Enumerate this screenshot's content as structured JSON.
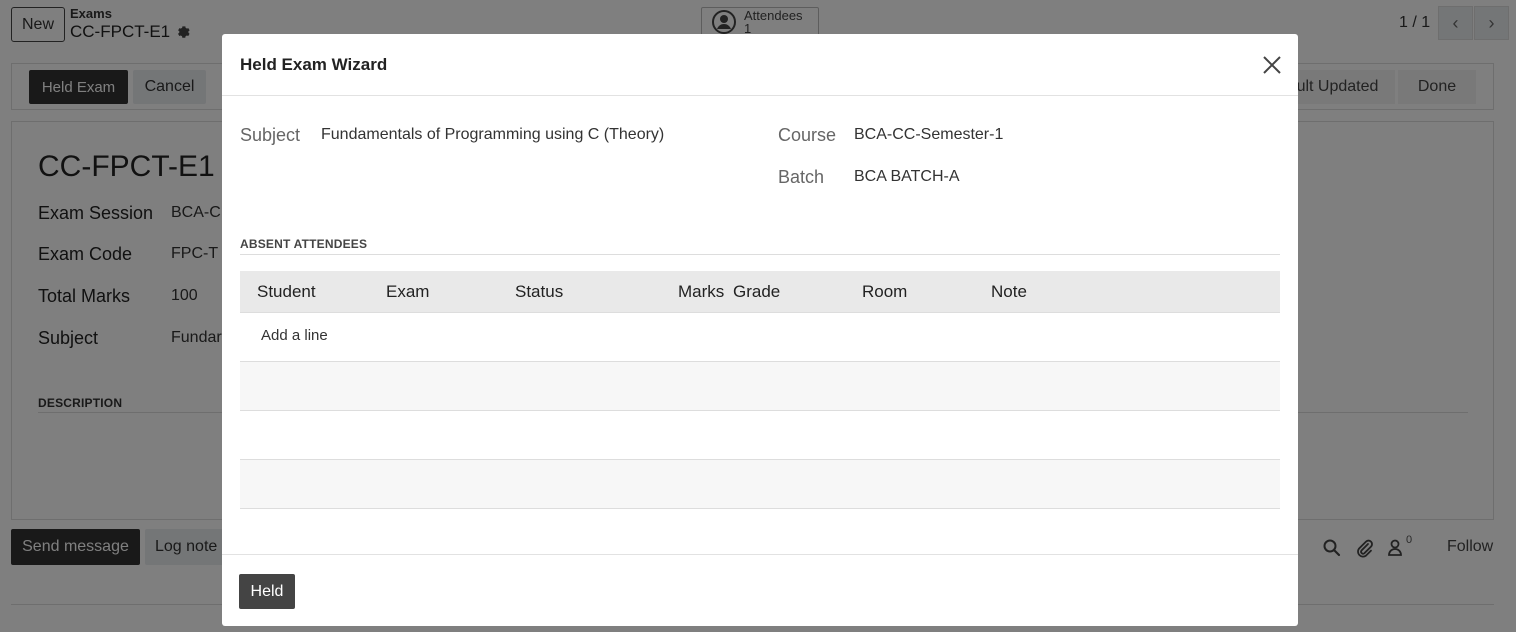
{
  "background": {
    "new_button": "New",
    "breadcrumb_parent": "Exams",
    "record_name": "CC-FPCT-E1",
    "smart_button": {
      "label": "Attendees",
      "count": "1"
    },
    "pager": {
      "value": "1 / 1"
    },
    "actions": {
      "held_exam": "Held Exam",
      "cancel": "Cancel"
    },
    "stages": {
      "result_updated": "ult Updated",
      "done": "Done"
    },
    "title": "CC-FPCT-E1",
    "fields": [
      {
        "label": "Exam Session",
        "value": "BCA-C"
      },
      {
        "label": "Exam Code",
        "value": "FPC-T"
      },
      {
        "label": "Total Marks",
        "value": "100"
      },
      {
        "label": "Subject",
        "value": "Fundar"
      }
    ],
    "description_label": "DESCRIPTION",
    "chatter": {
      "send_message": "Send message",
      "log_note": "Log note",
      "followers_count": "0",
      "follow": "Follow"
    }
  },
  "modal": {
    "title": "Held Exam Wizard",
    "subject": {
      "label": "Subject",
      "value": "Fundamentals of Programming using C (Theory)"
    },
    "course": {
      "label": "Course",
      "value": "BCA-CC-Semester-1"
    },
    "batch": {
      "label": "Batch",
      "value": "BCA BATCH-A"
    },
    "section_title": "ABSENT ATTENDEES",
    "columns": [
      "Student",
      "Exam",
      "Status",
      "Marks",
      "Grade",
      "Room",
      "Note"
    ],
    "add_line": "Add a line",
    "held_button": "Held"
  }
}
